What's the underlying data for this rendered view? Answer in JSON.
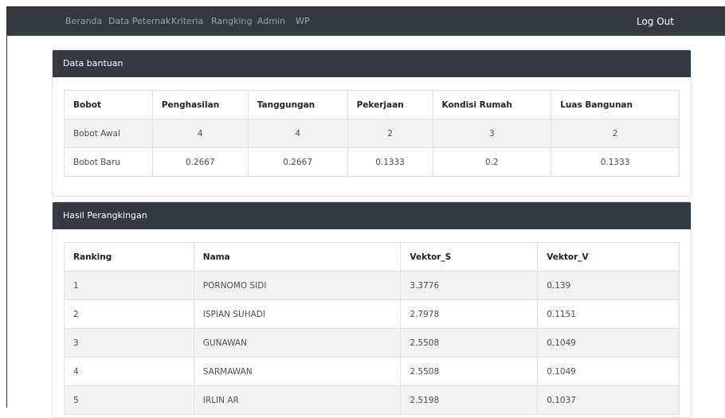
{
  "nav": {
    "links": [
      "Beranda",
      "Data Peternak",
      "Kriteria",
      "Rangking",
      "Admin",
      "WP"
    ],
    "logout": "Log Out"
  },
  "bantuan": {
    "title": "Data bantuan",
    "headers": [
      "Bobot",
      "Penghasilan",
      "Tanggungan",
      "Pekerjaan",
      "Kondisi Rumah",
      "Luas Bangunan"
    ],
    "rows": [
      [
        "Bobot Awal",
        "4",
        "4",
        "2",
        "3",
        "2"
      ],
      [
        "Bobot Baru",
        "0.2667",
        "0.2667",
        "0.1333",
        "0.2",
        "0.1333"
      ]
    ]
  },
  "ranking": {
    "title": "Hasil Perangkingan",
    "headers": [
      "Ranking",
      "Nama",
      "Vektor_S",
      "Vektor_V"
    ],
    "rows": [
      [
        "1",
        "PORNOMO SIDI",
        "3.3776",
        "0.139"
      ],
      [
        "2",
        "ISPIAN SUHADI",
        "2.7978",
        "0.1151"
      ],
      [
        "3",
        "GUNAWAN",
        "2.5508",
        "0.1049"
      ],
      [
        "4",
        "SARMAWAN",
        "2.5508",
        "0.1049"
      ],
      [
        "5",
        "IRLIN AR",
        "2.5198",
        "0.1037"
      ]
    ]
  }
}
